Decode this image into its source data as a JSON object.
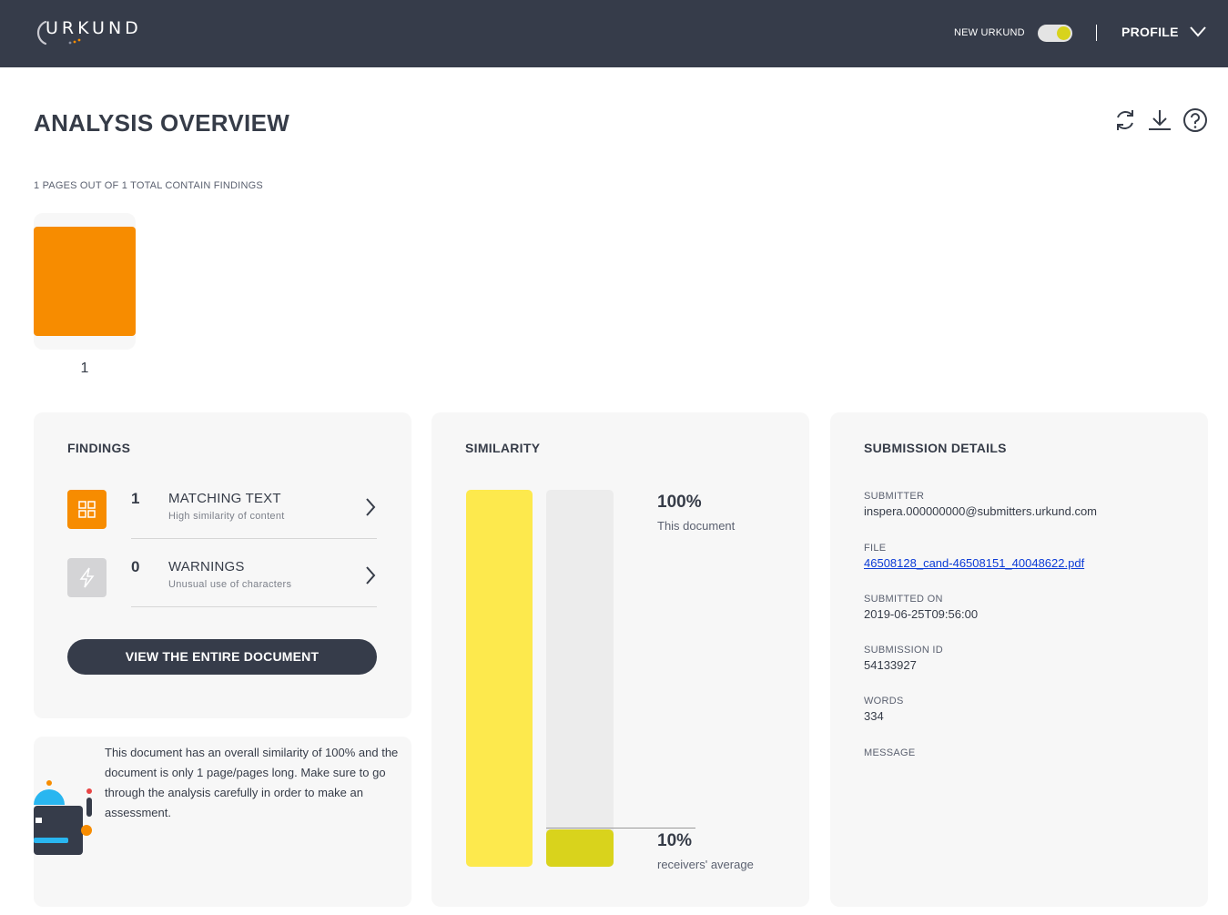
{
  "header": {
    "logo_text": "URKUND",
    "new_urkund_label": "NEW URKUND",
    "toggle_on": true,
    "profile_label": "PROFILE"
  },
  "page": {
    "title": "ANALYSIS OVERVIEW",
    "pages_info": "1 PAGES OUT OF 1 TOTAL CONTAIN FINDINGS",
    "thumb_number": "1",
    "toolbar": [
      "refresh-icon",
      "download-icon",
      "help-icon"
    ]
  },
  "findings": {
    "title": "FINDINGS",
    "items": [
      {
        "count": "1",
        "label": "MATCHING TEXT",
        "sub": "High similarity of content",
        "icon": "grid-icon",
        "color": "#f78c00"
      },
      {
        "count": "0",
        "label": "WARNINGS",
        "sub": "Unusual use of characters",
        "icon": "lightning-icon",
        "color": "#d4d4d6"
      }
    ],
    "button_label": "VIEW THE ENTIRE DOCUMENT"
  },
  "assistant": {
    "text": "This document has an overall similarity of 100% and the document is only 1 page/pages long. Make sure to go through the analysis carefully in order to make an assessment."
  },
  "similarity": {
    "title": "SIMILARITY",
    "document_value": "100%",
    "document_label": "This document",
    "average_value": "10%",
    "average_label": "receivers' average",
    "document_fraction": 1.0,
    "average_fraction": 0.1,
    "colors": {
      "document": "#fde94d",
      "average": "#d9d31c",
      "track": "#ececec"
    }
  },
  "details": {
    "title": "SUBMISSION DETAILS",
    "submitter_label": "SUBMITTER",
    "submitter": "inspera.000000000@submitters.urkund.com",
    "file_label": "FILE",
    "file": "46508128_cand-46508151_40048622.pdf",
    "submitted_on_label": "SUBMITTED ON",
    "submitted_on": "2019-06-25T09:56:00",
    "submission_id_label": "SUBMISSION ID",
    "submission_id": "54133927",
    "words_label": "WORDS",
    "words": "334",
    "message_label": "MESSAGE"
  }
}
